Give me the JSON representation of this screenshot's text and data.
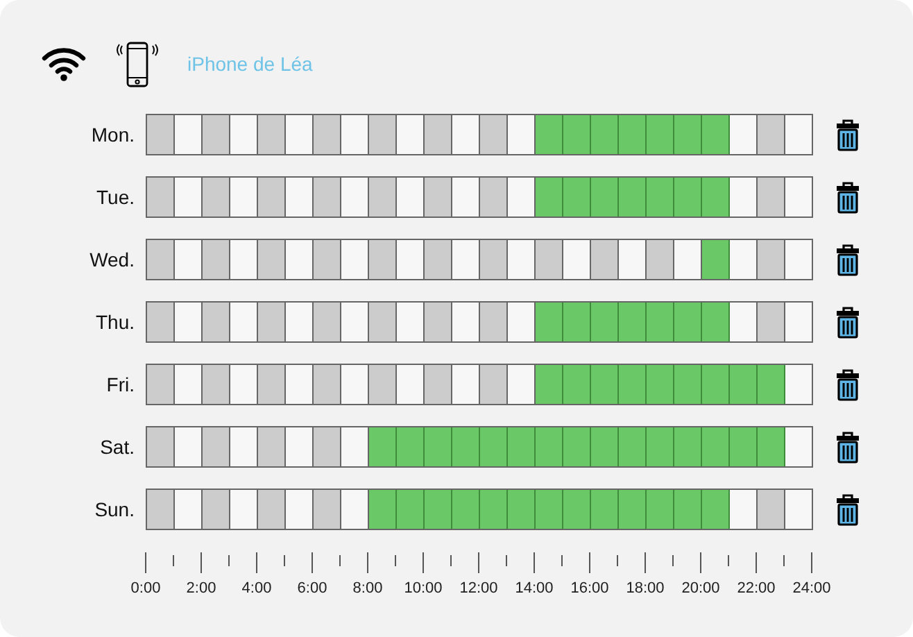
{
  "header": {
    "device_name": "iPhone de Léa"
  },
  "days": [
    {
      "label": "Mon.",
      "hours": [
        false,
        false,
        false,
        false,
        false,
        false,
        false,
        false,
        false,
        false,
        false,
        false,
        false,
        false,
        true,
        true,
        true,
        true,
        true,
        true,
        true,
        false,
        false,
        false
      ]
    },
    {
      "label": "Tue.",
      "hours": [
        false,
        false,
        false,
        false,
        false,
        false,
        false,
        false,
        false,
        false,
        false,
        false,
        false,
        false,
        true,
        true,
        true,
        true,
        true,
        true,
        true,
        false,
        false,
        false
      ]
    },
    {
      "label": "Wed.",
      "hours": [
        false,
        false,
        false,
        false,
        false,
        false,
        false,
        false,
        false,
        false,
        false,
        false,
        false,
        false,
        false,
        false,
        false,
        false,
        false,
        false,
        true,
        false,
        false,
        false
      ]
    },
    {
      "label": "Thu.",
      "hours": [
        false,
        false,
        false,
        false,
        false,
        false,
        false,
        false,
        false,
        false,
        false,
        false,
        false,
        false,
        true,
        true,
        true,
        true,
        true,
        true,
        true,
        false,
        false,
        false
      ]
    },
    {
      "label": "Fri.",
      "hours": [
        false,
        false,
        false,
        false,
        false,
        false,
        false,
        false,
        false,
        false,
        false,
        false,
        false,
        false,
        true,
        true,
        true,
        true,
        true,
        true,
        true,
        true,
        true,
        false
      ]
    },
    {
      "label": "Sat.",
      "hours": [
        false,
        false,
        false,
        false,
        false,
        false,
        false,
        false,
        true,
        true,
        true,
        true,
        true,
        true,
        true,
        true,
        true,
        true,
        true,
        true,
        true,
        true,
        true,
        false
      ]
    },
    {
      "label": "Sun.",
      "hours": [
        false,
        false,
        false,
        false,
        false,
        false,
        false,
        false,
        true,
        true,
        true,
        true,
        true,
        true,
        true,
        true,
        true,
        true,
        true,
        true,
        true,
        false,
        false,
        false
      ]
    }
  ],
  "axis_labels": [
    "0:00",
    "2:00",
    "4:00",
    "6:00",
    "8:00",
    "10:00",
    "12:00",
    "14:00",
    "16:00",
    "18:00",
    "20:00",
    "22:00",
    "24:00"
  ]
}
